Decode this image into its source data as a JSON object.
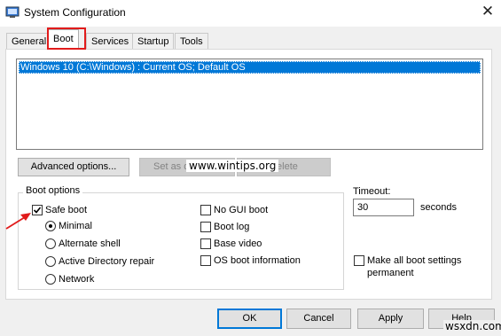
{
  "window": {
    "title": "System Configuration",
    "close_glyph": "✕",
    "icon": "system-config-icon"
  },
  "tabs": [
    {
      "label": "General",
      "active": false
    },
    {
      "label": "Boot",
      "active": true
    },
    {
      "label": "Services",
      "active": false
    },
    {
      "label": "Startup",
      "active": false
    },
    {
      "label": "Tools",
      "active": false
    }
  ],
  "boot_list": {
    "items": [
      "Windows 10 (C:\\Windows) : Current OS; Default OS"
    ],
    "selected_index": 0
  },
  "buttons": {
    "advanced": "Advanced options...",
    "set_default": "Set as default",
    "delete": "Delete",
    "ok": "OK",
    "cancel": "Cancel",
    "apply": "Apply",
    "help": "Help"
  },
  "boot_options": {
    "label": "Boot options",
    "safe_boot": {
      "label": "Safe boot",
      "checked": true
    },
    "radios": [
      {
        "label": "Minimal",
        "selected": true
      },
      {
        "label": "Alternate shell",
        "selected": false
      },
      {
        "label": "Active Directory repair",
        "selected": false
      },
      {
        "label": "Network",
        "selected": false
      }
    ],
    "checks": [
      {
        "label": "No GUI boot",
        "checked": false
      },
      {
        "label": "Boot log",
        "checked": false
      },
      {
        "label": "Base video",
        "checked": false
      },
      {
        "label": "OS boot information",
        "checked": false
      }
    ]
  },
  "timeout": {
    "label": "Timeout:",
    "value": "30",
    "units": "seconds"
  },
  "make_permanent": {
    "label": "Make all boot settings permanent",
    "checked": false
  },
  "watermarks": {
    "center": "www.wintips.org",
    "corner": "wsxdn.com"
  },
  "colors": {
    "selection": "#0078d7",
    "highlight_box": "#e11b1b",
    "annotation_arrow": "#e11b1b"
  }
}
